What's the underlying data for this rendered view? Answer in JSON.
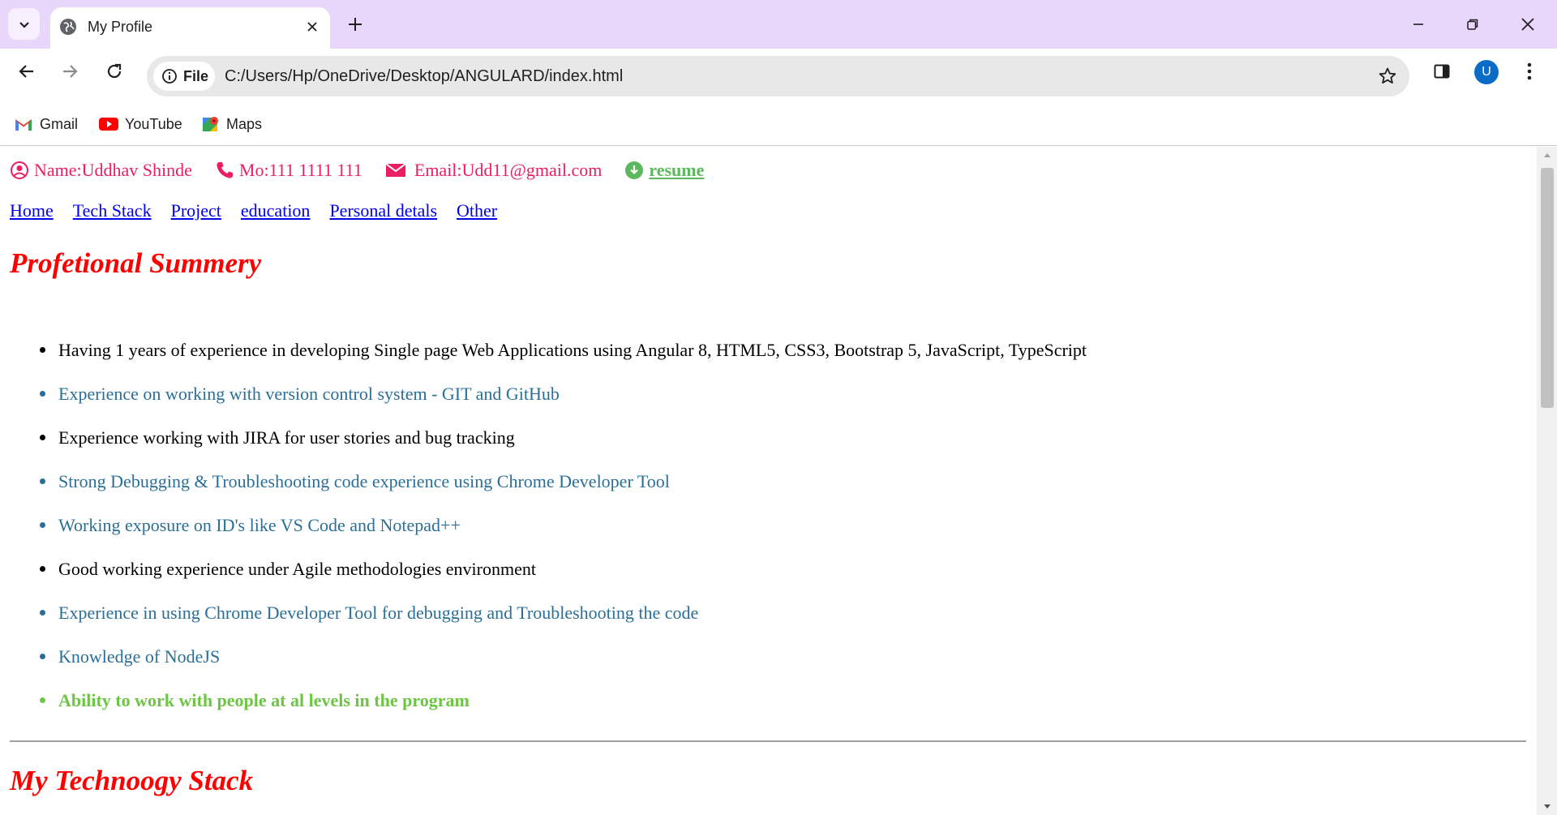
{
  "browser": {
    "tab_title": "My Profile",
    "chip_label": "File",
    "url": "C:/Users/Hp/OneDrive/Desktop/ANGULARD/index.html",
    "avatar_letter": "U",
    "bookmarks": [
      {
        "label": "Gmail"
      },
      {
        "label": "YouTube"
      },
      {
        "label": "Maps"
      }
    ]
  },
  "contact": {
    "name": "Name:Uddhav Shinde",
    "mobile": "Mo:111 1111 111",
    "email": "Email:Udd11@gmail.com",
    "resume": "resume",
    "color": "#e91e63",
    "resume_color": "#5cb85c"
  },
  "nav": [
    "Home",
    "Tech Stack",
    "Project",
    "education",
    "Personal detals",
    "Other"
  ],
  "sections": {
    "summary_title": "Profetional Summery",
    "stack_title": "My Technoogy Stack"
  },
  "summary_items": [
    {
      "text": "Having 1 years of experience in developing Single page Web Applications using Angular 8, HTML5, CSS3, Bootstrap 5, JavaScript, TypeScript",
      "style": "black"
    },
    {
      "text": "Experience on working with version control system - GIT and GitHub",
      "style": "blue"
    },
    {
      "text": "Experience working with JIRA for user stories and bug tracking",
      "style": "black"
    },
    {
      "text": "Strong Debugging & Troubleshooting code experience using Chrome Developer Tool",
      "style": "blue"
    },
    {
      "text": "Working exposure on ID's like VS Code and Notepad++",
      "style": "blue"
    },
    {
      "text": "Good working experience under Agile methodologies environment",
      "style": "black"
    },
    {
      "text": "Experience in using Chrome Developer Tool for debugging and Troubleshooting the code",
      "style": "blue"
    },
    {
      "text": "Knowledge of NodeJS",
      "style": "blue"
    },
    {
      "text": "Ability to work with people at al levels in the program",
      "style": "green"
    }
  ],
  "colors": {
    "heading": "#ff0000",
    "link": "#0000ee",
    "black": "#000000",
    "blue": "#2a6f97",
    "green": "#6cc644",
    "tabbar": "#e8d7fb"
  }
}
